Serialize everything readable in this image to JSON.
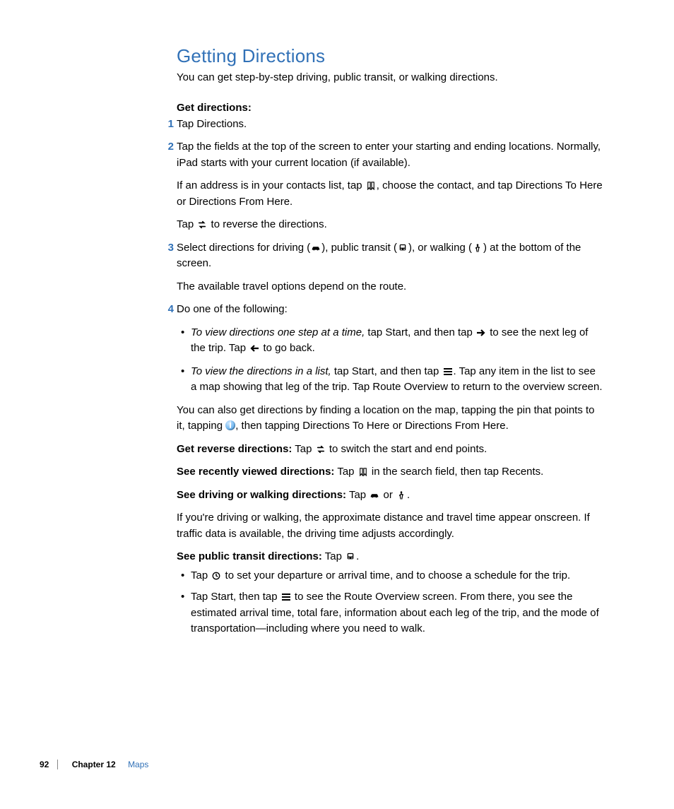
{
  "title": "Getting Directions",
  "intro": "You can get step-by-step driving, public transit, or walking directions.",
  "subhead1": "Get directions:",
  "steps": {
    "s1": "Tap Directions.",
    "s2a": "Tap the fields at the top of the screen to enter your starting and ending locations. Normally, iPad starts with your current location (if available).",
    "s2b_pre": "If an address is in your contacts list, tap ",
    "s2b_post": ", choose the contact, and tap Directions To Here or Directions From Here.",
    "s2c_pre": "Tap ",
    "s2c_post": " to reverse the directions.",
    "s3_pre": "Select directions for driving (",
    "s3_mid1": "), public transit (",
    "s3_mid2": "), or walking (",
    "s3_post": ") at the bottom of the screen.",
    "s3b": "The available travel options depend on the route.",
    "s4": "Do one of the following:",
    "s4_li1_lead": "To view directions one step at a time,",
    "s4_li1_a": " tap Start, and then tap ",
    "s4_li1_b": " to see the next leg of the trip. Tap ",
    "s4_li1_c": " to go back.",
    "s4_li2_lead": "To view the directions in a list,",
    "s4_li2_a": " tap Start, and then tap ",
    "s4_li2_b": ". Tap any item in the list to see a map showing that leg of the trip. Tap Route Overview to return to the overview screen."
  },
  "para_alt_pre": "You can also get directions by finding a location on the map, tapping the pin that points to it, tapping ",
  "para_alt_post": ", then tapping Directions To Here or Directions From Here.",
  "reverse_label": "Get reverse directions:",
  "reverse_pre": "  Tap ",
  "reverse_post": " to switch the start and end points.",
  "recent_label": "See recently viewed directions:",
  "recent_pre": "  Tap ",
  "recent_post": " in the search field, then tap Recents.",
  "drivewalk_label": "See driving or walking directions:",
  "drivewalk_pre": "  Tap ",
  "drivewalk_or": " or ",
  "drivewalk_post": ".",
  "para_drive": "If you're driving or walking, the approximate distance and travel time appear onscreen. If traffic data is available, the driving time adjusts accordingly.",
  "transit_label": "See public transit directions:",
  "transit_pre": "  Tap ",
  "transit_post": ".",
  "transit_li1_pre": "Tap ",
  "transit_li1_post": " to set your departure or arrival time, and to choose a schedule for the trip.",
  "transit_li2_pre": "Tap Start, then tap ",
  "transit_li2_post": " to see the Route Overview screen. From there, you see the estimated arrival time, total fare, information about each leg of the trip, and the mode of transportation—including where you need to walk.",
  "footer": {
    "page": "92",
    "chapter": "Chapter 12",
    "title": "Maps"
  }
}
